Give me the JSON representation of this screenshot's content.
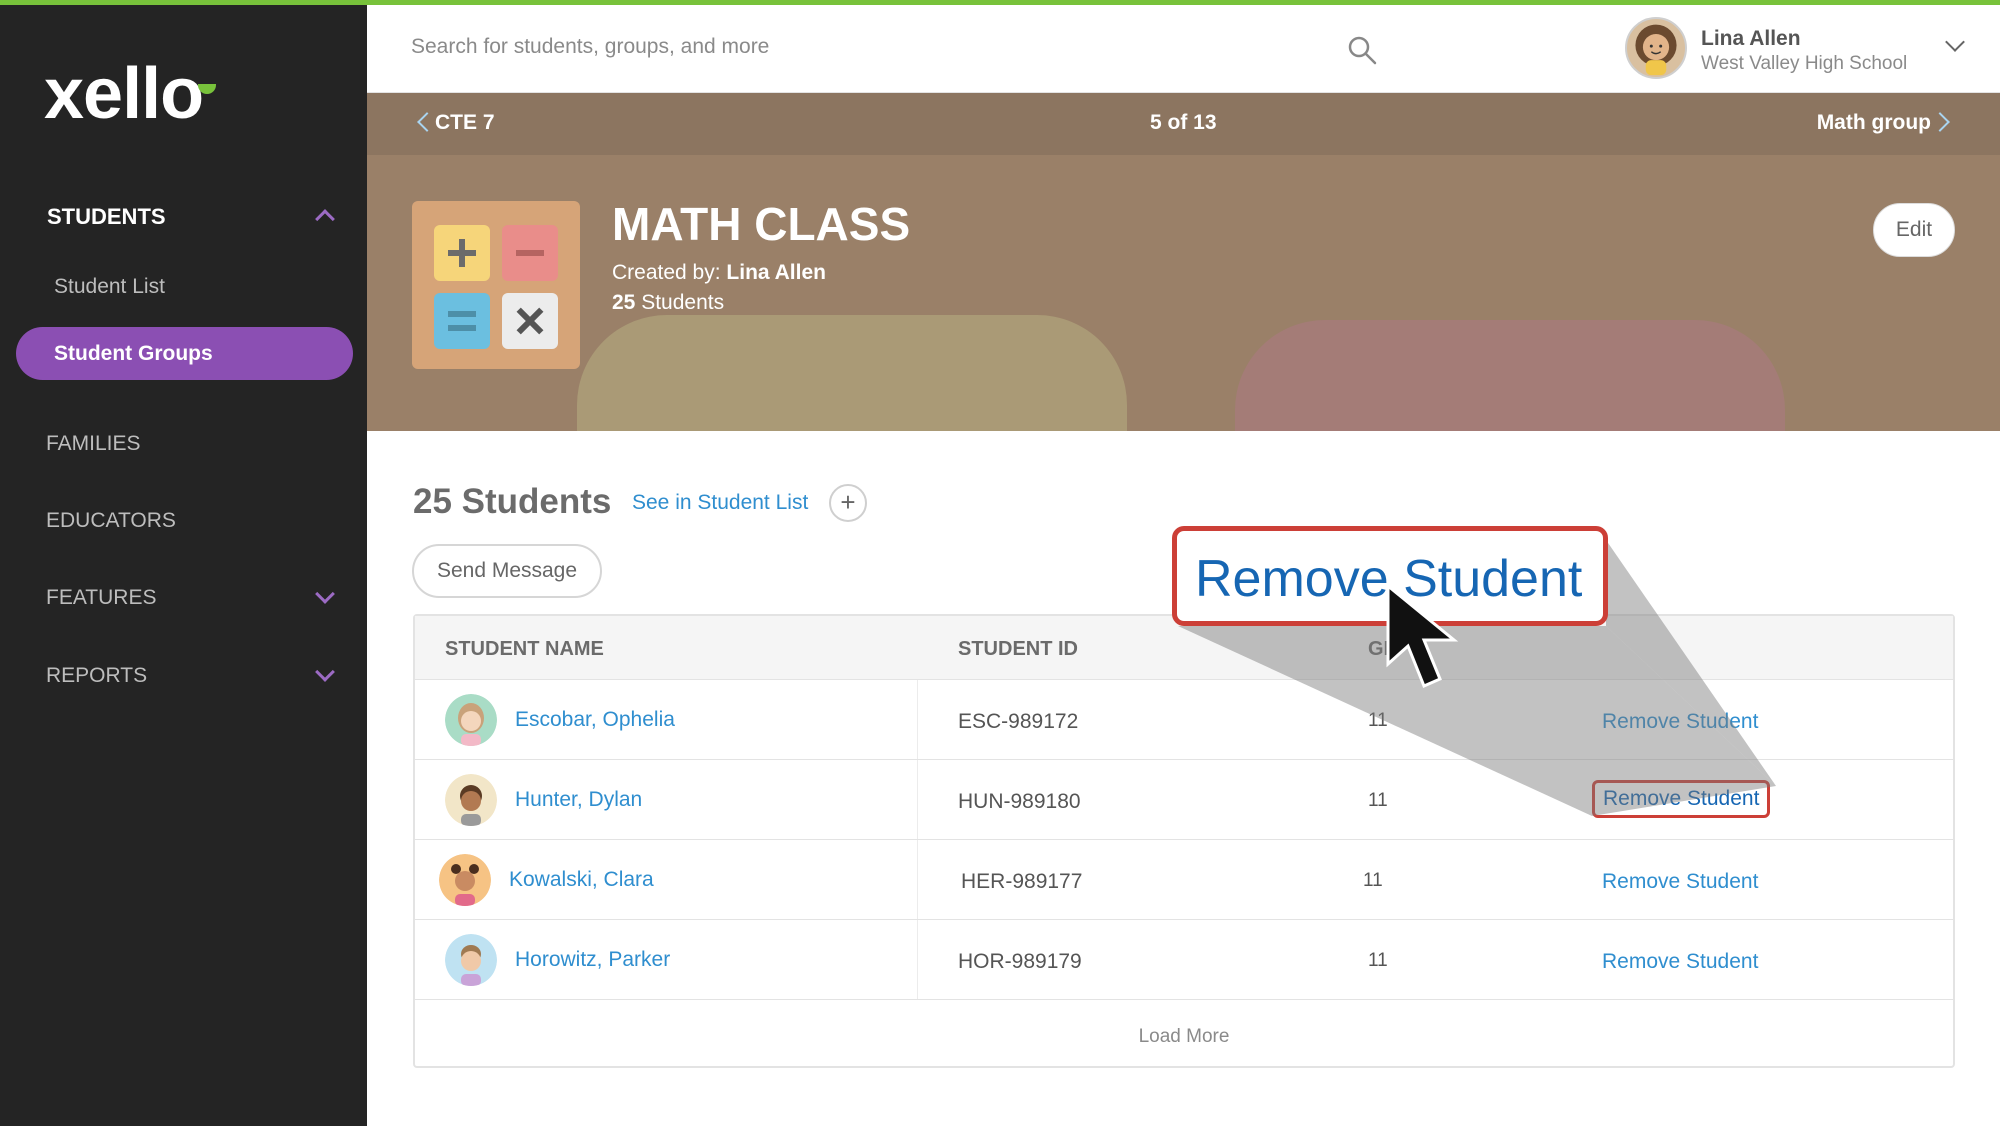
{
  "app": {
    "logo_text": "xello"
  },
  "sidebar": {
    "students_label": "STUDENTS",
    "student_list_label": "Student List",
    "student_groups_label": "Student Groups",
    "families_label": "FAMILIES",
    "educators_label": "EDUCATORS",
    "features_label": "FEATURES",
    "reports_label": "REPORTS"
  },
  "topbar": {
    "search_placeholder": "Search for students, groups, and more",
    "user_name": "Lina Allen",
    "user_school": "West Valley High School"
  },
  "group_nav": {
    "prev_label": "CTE 7",
    "position": "5 of 13",
    "next_label": "Math group"
  },
  "group": {
    "title": "MATH CLASS",
    "created_by_prefix": "Created by: ",
    "created_by_name": "Lina Allen",
    "student_count_num": "25",
    "student_count_word": " Students",
    "edit_label": "Edit"
  },
  "content": {
    "count_title": "25 Students",
    "see_link": "See in Student List",
    "add_symbol": "+",
    "send_message_label": "Send Message",
    "columns": [
      "STUDENT NAME",
      "STUDENT ID",
      "GR"
    ],
    "rows": [
      {
        "name": "Escobar, Ophelia",
        "id": "ESC-989172",
        "grade": "11",
        "action": "Remove Student"
      },
      {
        "name": "Hunter, Dylan",
        "id": "HUN-989180",
        "grade": "11",
        "action": "Remove Student"
      },
      {
        "name": "Kowalski, Clara",
        "id": "HER-989177",
        "grade": "11",
        "action": "Remove Student"
      },
      {
        "name": "Horowitz, Parker",
        "id": "HOR-989179",
        "grade": "11",
        "action": "Remove Student"
      }
    ],
    "load_more_label": "Load More"
  },
  "callout": {
    "text": "Remove Student"
  },
  "colors": {
    "accent_purple": "#8b4fb3",
    "link_blue": "#2f8ecf",
    "highlight_red": "#cc3f37",
    "brand_green": "#78c23b"
  },
  "icons": [
    "search-icon",
    "chevron-up-icon",
    "chevron-down-icon",
    "chevron-left-icon",
    "chevron-right-icon",
    "plus-icon",
    "cursor-icon"
  ]
}
